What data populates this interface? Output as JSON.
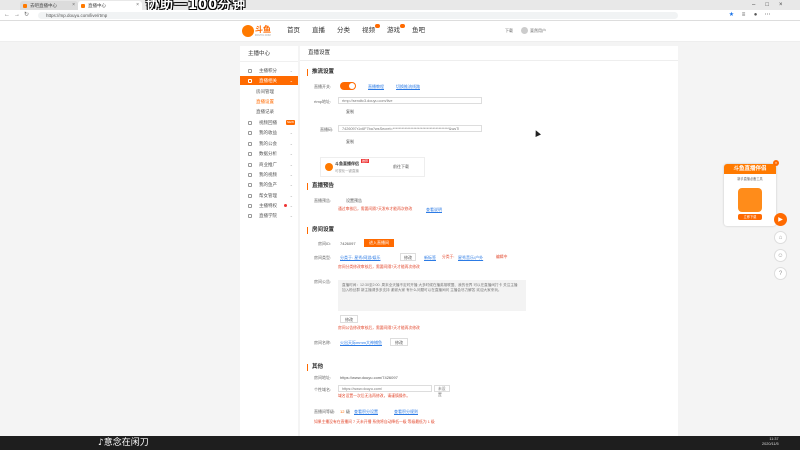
{
  "browser": {
    "tabs": [
      {
        "label": "去吧直播中心",
        "active": false
      },
      {
        "label": "直播中心",
        "active": true
      }
    ],
    "url": "https://mp.douyu.com/live/rtmp",
    "nav_back": "←",
    "nav_forward": "→",
    "nav_reload": "↻",
    "overlay_title": "协助一100分钟"
  },
  "site": {
    "logo": {
      "text": "斗鱼",
      "sub": "DOUYU.COM"
    },
    "nav": [
      "首页",
      "直播",
      "分类",
      "视频",
      "游戏",
      "鱼吧"
    ],
    "download": "下载",
    "username": "斐然用户"
  },
  "sidebar": {
    "title": "主播中心",
    "items": [
      {
        "label": "主播积分",
        "active": false,
        "sub": false
      },
      {
        "label": "直播相关",
        "active": true,
        "sub": false
      },
      {
        "label": "房间管理",
        "active": false,
        "sub": true
      },
      {
        "label": "直播设置",
        "active": false,
        "sub": true,
        "selected": true
      },
      {
        "label": "直播记录",
        "active": false,
        "sub": true
      },
      {
        "label": "视频回播",
        "active": false,
        "sub": false,
        "badge": "NEW"
      },
      {
        "label": "我的收益",
        "active": false,
        "sub": false
      },
      {
        "label": "我的公会",
        "active": false,
        "sub": false
      },
      {
        "label": "数据分析",
        "active": false,
        "sub": false
      },
      {
        "label": "商业推广",
        "active": false,
        "sub": false
      },
      {
        "label": "我的视频",
        "active": false,
        "sub": false
      },
      {
        "label": "我的鱼产",
        "active": false,
        "sub": false
      },
      {
        "label": "帮女管理",
        "active": false,
        "sub": false
      },
      {
        "label": "主播特权",
        "active": false,
        "sub": false,
        "dot": true
      },
      {
        "label": "直播学院",
        "active": false,
        "sub": false
      }
    ]
  },
  "main": {
    "page_title": "直播设置",
    "stream": {
      "section": "推流设置",
      "toggle_label": "直播开关:",
      "toggle_on": true,
      "link_tutorial": "直播教程",
      "link_clip": "切换推流线路",
      "rtmp_label": "rtmp地址:",
      "rtmp_value": "rtmp://sendtc3.douyu.com/live",
      "copy": "复制",
      "code_label": "直播码:",
      "code_value": "7426097r1x6F7ba?wsSecret=**************************************&wsTi",
      "companion_title": "斗鱼直播伴侣",
      "companion_sub": "可视化一键直播",
      "companion_badge": "推荐",
      "companion_btn": "前往下载"
    },
    "preview": {
      "section": "直播预告",
      "label": "直播预告:",
      "btn": "设置预告",
      "warn": "通过审核后，需要间隔7天发布才能再次修改",
      "link": "查看说明"
    },
    "room": {
      "section": "房间设置",
      "roomid_label": "房间ID:",
      "roomid": "7426097",
      "apply_btn": "进入直播间",
      "cat_label": "房间类型:",
      "cat_link": "分类于: 星秀/网游/娱乐",
      "cat_btn": "修改",
      "tag_link": "新标签",
      "tag2": "分类于:",
      "tag3": "星秀音乐/户外",
      "tag4": "编辑中",
      "cat_warn": "房间分类修改审核后，需要间隔7天才能再次修改",
      "ann_label": "房间公告:",
      "announcement": "直播时间：12:30至2:00. 周末全天播不定时开播 大多时候在播英雄联盟、我的世界 可以在直播间打卡 关注主播 加入粉丝群 新主播请多多支持 谢谢大家 有什么问题可以在直播间问 主播会尽力解答 欢迎大家来玩。",
      "ann_btn": "修改",
      "ann_warn": "房间公告修改审核后，需要间隔7天才能再次修改",
      "name_label": "房间名称:",
      "name_link": "火出天际mmm大神捕鱼",
      "name_btn": "修改"
    },
    "other": {
      "section": "其他",
      "addr_label": "房间地址:",
      "addr": "https://www.douyu.com/7426097",
      "personal_label": "个性域名:",
      "personal_value": "https://www.douyu.com/",
      "personal_select": "未设置",
      "personal_warn": "域名设置一次后无法再修改，请谨慎操作。",
      "level_label": "直播间等级:",
      "level": "12",
      "level_unit": "级",
      "level_link1": "查看积分设置",
      "level_link2": "查看积分规则",
      "level_warn": "如果主播没有在直播间 7 天未开播 系统将自动降低一级 等级最低为 1 级"
    }
  },
  "promo": {
    "title": "斗鱼直播伴侣",
    "desc": "新手直播必备工具",
    "btn": "立即下载",
    "close": "×"
  },
  "rail": [
    "▶",
    "⌂",
    "☺",
    "?"
  ],
  "bottom": {
    "tiktok": "♪意念在闲刀",
    "time": "11:37",
    "date": "2020/11/5"
  }
}
